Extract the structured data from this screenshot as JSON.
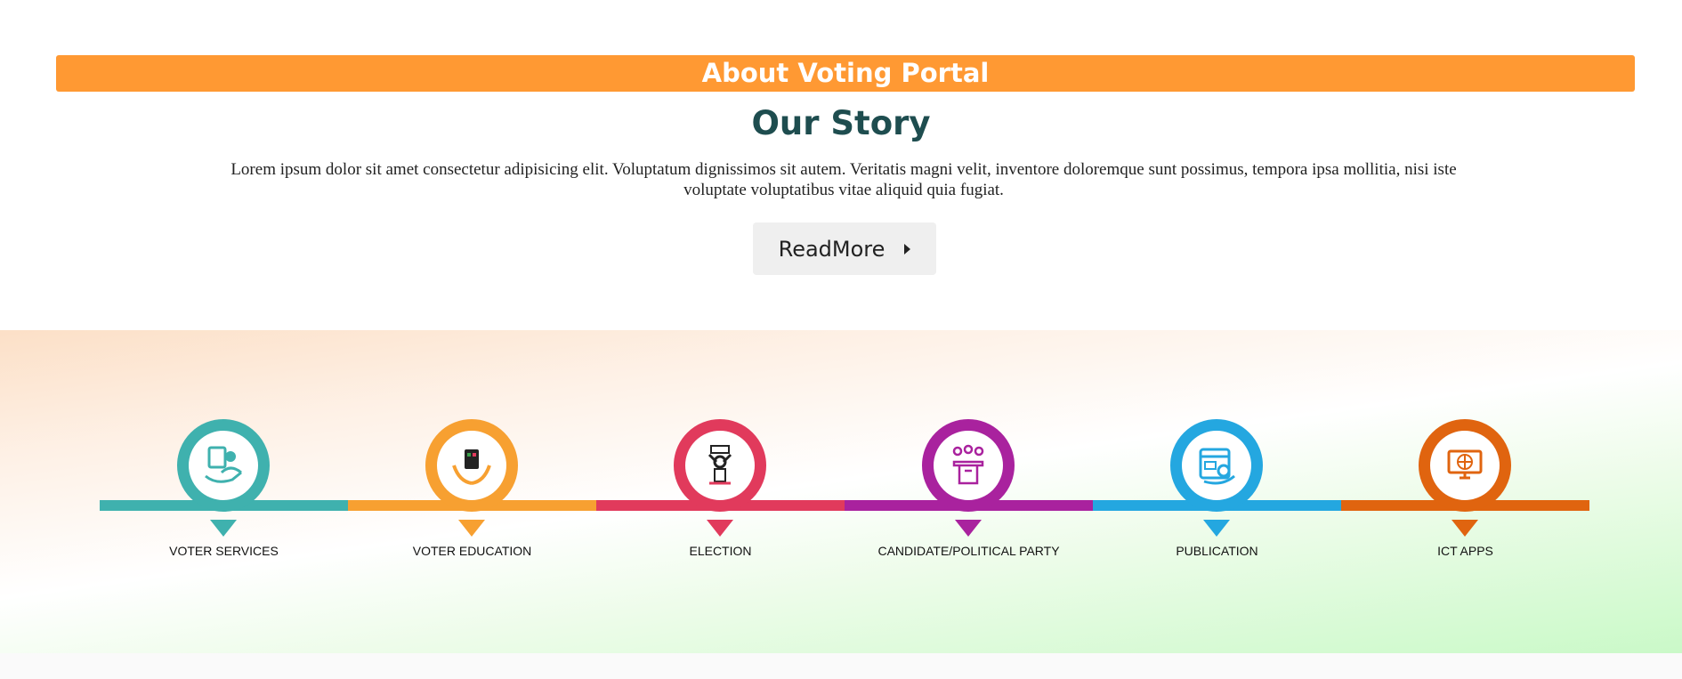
{
  "about": {
    "title": "About Voting Portal",
    "color": "#ff9933"
  },
  "story": {
    "title": "Our Story",
    "text": "Lorem ipsum dolor sit amet consectetur adipisicing elit. Voluptatum dignissimos sit autem. Veritatis magni velit, inventore doloremque sunt possimus, tempora ipsa mollitia, nisi iste voluptate voluptatibus vitae aliquid quia fugiat.",
    "readmore_label": "ReadMore",
    "readmore_icon": "caret-right-icon"
  },
  "services": [
    {
      "label": "VOTER SERVICES",
      "color": "#3fb1ae",
      "icon": "voter-services-icon"
    },
    {
      "label": "VOTER EDUCATION",
      "color": "#f7a031",
      "icon": "voter-education-icon"
    },
    {
      "label": "ELECTION",
      "color": "#e13a5c",
      "icon": "election-icon"
    },
    {
      "label": "CANDIDATE/POLITICAL PARTY",
      "color": "#a9229e",
      "icon": "candidate-party-icon"
    },
    {
      "label": "PUBLICATION",
      "color": "#24a7e0",
      "icon": "publication-icon"
    },
    {
      "label": "ICT APPS",
      "color": "#e0640f",
      "icon": "ict-apps-icon"
    }
  ]
}
